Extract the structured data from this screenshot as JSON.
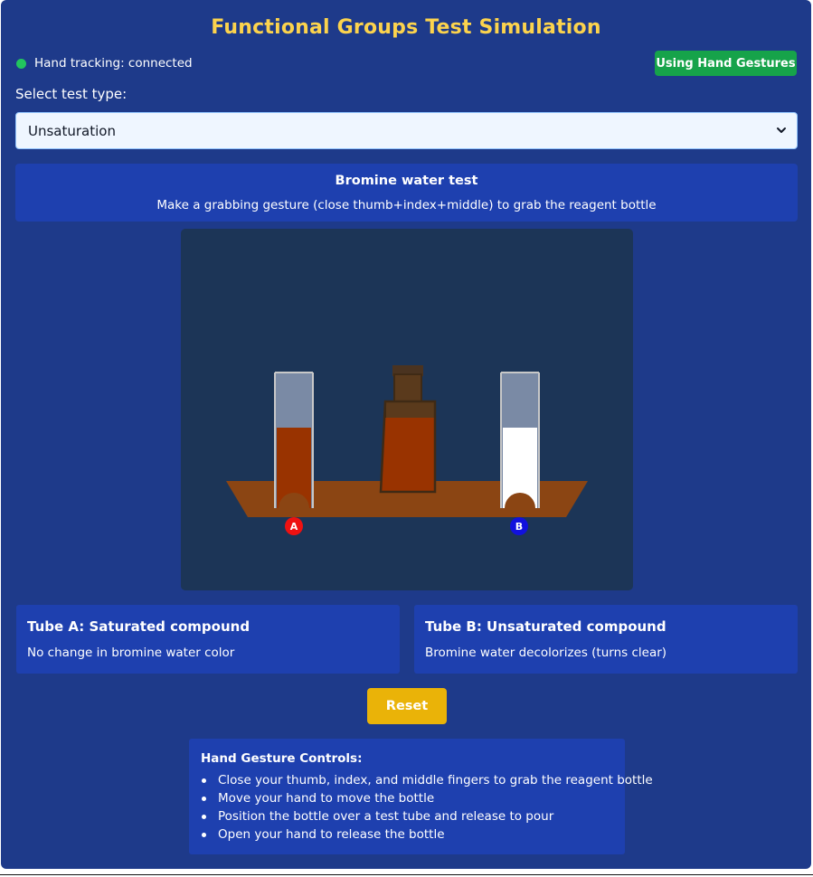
{
  "app": {
    "title": "Functional Groups Test Simulation",
    "tracking_status": "Hand tracking: connected",
    "tracking_color": "#22c55e",
    "mode_button": "Using Hand Gestures"
  },
  "test_select": {
    "label": "Select test type:",
    "selected": "Unsaturation"
  },
  "info": {
    "test_name": "Bromine water test",
    "instruction": "Make a grabbing gesture (close thumb+index+middle) to grab the reagent bottle"
  },
  "simulation": {
    "tube_a": {
      "label": "A",
      "liquid_color": "#993300",
      "marker_color": "#ee1111"
    },
    "tube_b": {
      "label": "B",
      "liquid_color": "#ffffff",
      "marker_color": "#1111dd"
    },
    "reagent_color": "#993300"
  },
  "results": {
    "a_title": "Tube A: Saturated compound",
    "a_text": "No change in bromine water color",
    "b_title": "Tube B: Unsaturated compound",
    "b_text": "Bromine water decolorizes (turns clear)"
  },
  "reset_button": "Reset",
  "controls": {
    "title": "Hand Gesture Controls:",
    "items": [
      "Close your thumb, index, and middle fingers to grab the reagent bottle",
      "Move your hand to move the bottle",
      "Position the bottle over a test tube and release to pour",
      "Open your hand to release the bottle"
    ]
  }
}
